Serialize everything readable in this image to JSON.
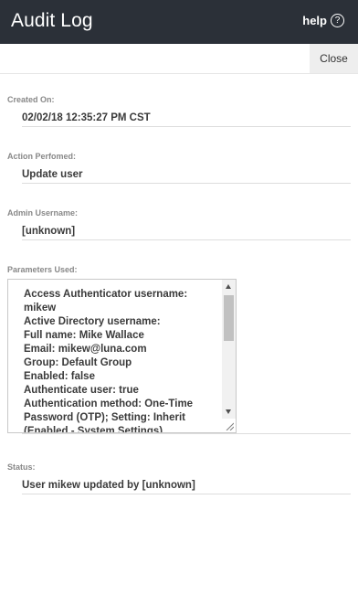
{
  "header": {
    "title": "Audit Log",
    "help_label": "help",
    "help_icon_glyph": "?"
  },
  "toolbar": {
    "close_label": "Close"
  },
  "fields": {
    "created_on": {
      "label": "Created On:",
      "value": "02/02/18 12:35:27 PM CST"
    },
    "action_performed": {
      "label": "Action Perfomed:",
      "value": "Update user"
    },
    "admin_username": {
      "label": "Admin Username:",
      "value": "[unknown]"
    },
    "parameters_used": {
      "label": "Parameters Used:",
      "lines": [
        "Access Authenticator username:",
        "mikew",
        "Active Directory username:",
        "Full name: Mike Wallace",
        "Email: mikew@luna.com",
        "Group: Default Group",
        "Enabled: false",
        "Authenticate user: true",
        "Authentication method: One-Time",
        "Password (OTP); Setting: Inherit",
        "(Enabled - System Settings)"
      ]
    },
    "status": {
      "label": "Status:",
      "value": "User mikew updated by [unknown]"
    }
  },
  "colors": {
    "header_bg": "#2b3038",
    "close_bg": "#eeeeee"
  }
}
